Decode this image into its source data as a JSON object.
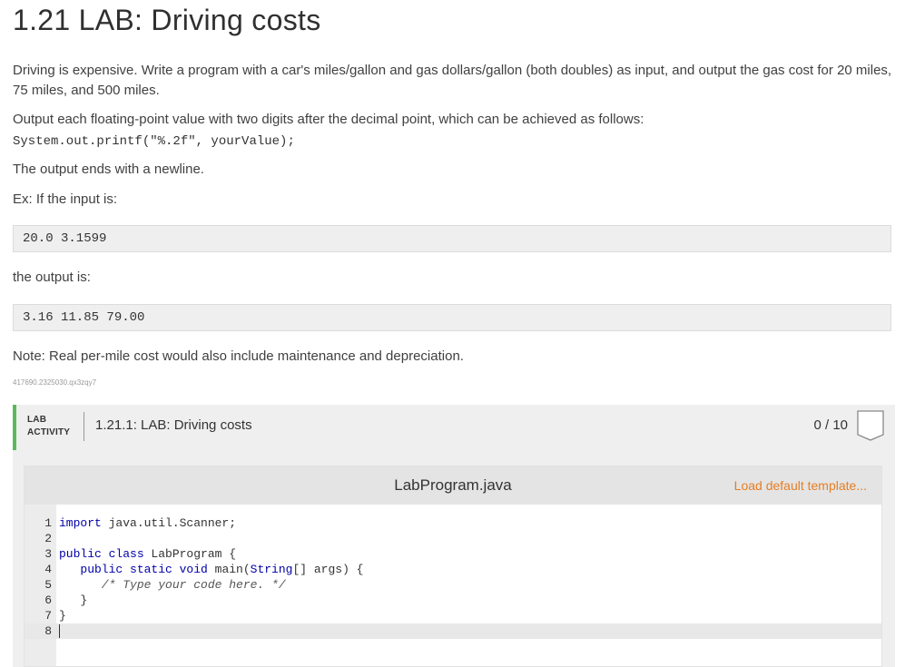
{
  "title": "1.21 LAB: Driving costs",
  "description": {
    "p1": "Driving is expensive. Write a program with a car's miles/gallon and gas dollars/gallon (both doubles) as input, and output the gas cost for 20 miles, 75 miles, and 500 miles.",
    "p2": "Output each floating-point value with two digits after the decimal point, which can be achieved as follows:",
    "code_example": "System.out.printf(\"%.2f\", yourValue);",
    "p3": "The output ends with a newline.",
    "p4": "Ex: If the input is:",
    "input_example": "20.0 3.1599",
    "p5": "the output is:",
    "output_example": "3.16 11.85 79.00",
    "note": "Note: Real per-mile cost would also include maintenance and depreciation.",
    "activity_id": "417690.2325030.qx3zqy7"
  },
  "lab": {
    "label_line1": "LAB",
    "label_line2": "ACTIVITY",
    "title": "1.21.1: LAB: Driving costs",
    "score": "0 / 10",
    "badge_icon": "shield-icon"
  },
  "editor": {
    "file_name": "LabProgram.java",
    "load_template": "Load default template...",
    "lines": [
      {
        "num": "1",
        "text": "import java.util.Scanner;"
      },
      {
        "num": "2",
        "text": ""
      },
      {
        "num": "3",
        "text": "public class LabProgram {"
      },
      {
        "num": "4",
        "text": "   public static void main(String[] args) {"
      },
      {
        "num": "5",
        "text": "      /* Type your code here. */"
      },
      {
        "num": "6",
        "text": "   }"
      },
      {
        "num": "7",
        "text": "}"
      },
      {
        "num": "8",
        "text": ""
      }
    ]
  },
  "colors": {
    "accent_green": "#5cb85c",
    "link_orange": "#e67e22"
  }
}
